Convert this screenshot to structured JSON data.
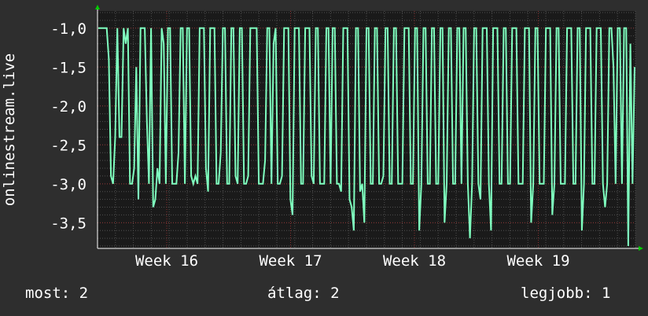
{
  "chart_data": {
    "type": "line",
    "ylabel": "onlinestream.live",
    "ylim": [
      -3.83,
      -0.78
    ],
    "y_ticks": [
      -1.0,
      -1.5,
      -2.0,
      -2.5,
      -3.0,
      -3.5
    ],
    "y_tick_labels": [
      "-1,0",
      "-1,5",
      "-2,0",
      "-2,5",
      "-3,0",
      "-3,5"
    ],
    "x_tick_labels": [
      "Week 16",
      "Week 17",
      "Week 18",
      "Week 19"
    ],
    "grid": true,
    "colors": {
      "background": "#2e2e2e",
      "plot_area": "#1a1a1a",
      "line": "#7fffbf",
      "grid_major": "#8a3030",
      "grid_minor": "#505050",
      "axis_arrow": "#00cc00"
    },
    "series": [
      {
        "values": [
          -1.0,
          -1.0,
          -1.0,
          -1.0,
          -1.0,
          -1.4,
          -2.9,
          -3.0,
          -2.4,
          -1.0,
          -2.4,
          -2.4,
          -1.0,
          -1.2,
          -1.0,
          -3.0,
          -3.0,
          -2.8,
          -1.5,
          -3.2,
          -1.0,
          -1.0,
          -1.0,
          -2.2,
          -3.0,
          -1.0,
          -3.3,
          -3.2,
          -2.8,
          -3.0,
          -1.0,
          -1.2,
          -3.0,
          -1.0,
          -1.0,
          -3.0,
          -3.0,
          -3.0,
          -2.6,
          -1.0,
          -1.0,
          -3.0,
          -1.0,
          -1.0,
          -2.9,
          -3.0,
          -2.9,
          -3.0,
          -1.0,
          -1.0,
          -1.0,
          -2.8,
          -3.1,
          -1.0,
          -1.0,
          -1.0,
          -3.0,
          -3.0,
          -2.6,
          -1.0,
          -1.0,
          -3.0,
          -3.0,
          -1.0,
          -1.0,
          -2.9,
          -3.0,
          -1.0,
          -1.0,
          -3.0,
          -3.0,
          -2.9,
          -1.0,
          -1.0,
          -1.0,
          -1.0,
          -3.0,
          -3.0,
          -3.0,
          -2.7,
          -1.0,
          -1.0,
          -3.0,
          -1.2,
          -1.0,
          -3.0,
          -3.0,
          -2.9,
          -1.0,
          -1.0,
          -1.0,
          -3.2,
          -3.4,
          -1.0,
          -1.0,
          -1.0,
          -3.0,
          -3.0,
          -1.0,
          -1.0,
          -1.0,
          -2.9,
          -3.0,
          -1.0,
          -1.0,
          -3.0,
          -3.0,
          -3.0,
          -1.0,
          -1.0,
          -3.0,
          -1.0,
          -1.0,
          -3.0,
          -3.0,
          -3.1,
          -1.0,
          -1.0,
          -1.0,
          -3.2,
          -3.3,
          -3.6,
          -1.0,
          -1.0,
          -3.1,
          -3.0,
          -3.5,
          -1.0,
          -1.0,
          -3.0,
          -3.0,
          -1.0,
          -1.0,
          -3.0,
          -3.0,
          -2.9,
          -1.0,
          -1.0,
          -3.0,
          -3.0,
          -1.0,
          -1.0,
          -3.0,
          -3.0,
          -3.0,
          -1.0,
          -1.0,
          -1.0,
          -3.0,
          -3.0,
          -1.0,
          -1.0,
          -3.6,
          -3.0,
          -1.0,
          -1.0,
          -3.0,
          -3.0,
          -1.0,
          -1.0,
          -3.0,
          -3.0,
          -1.0,
          -1.0,
          -3.5,
          -3.0,
          -1.0,
          -1.0,
          -3.0,
          -3.0,
          -1.0,
          -1.0,
          -3.0,
          -1.0,
          -1.0,
          -3.0,
          -3.7,
          -3.0,
          -1.0,
          -1.0,
          -3.0,
          -3.2,
          -1.0,
          -1.0,
          -1.0,
          -3.0,
          -3.6,
          -1.0,
          -1.0,
          -1.0,
          -3.0,
          -3.0,
          -1.0,
          -1.0,
          -3.0,
          -3.0,
          -1.0,
          -1.0,
          -1.0,
          -3.0,
          -3.0,
          -3.0,
          -1.0,
          -1.0,
          -1.0,
          -3.5,
          -3.0,
          -1.0,
          -1.0,
          -3.0,
          -3.0,
          -3.0,
          -1.0,
          -1.0,
          -1.0,
          -3.4,
          -3.0,
          -1.0,
          -1.0,
          -3.0,
          -3.0,
          -3.0,
          -1.0,
          -1.0,
          -1.0,
          -3.0,
          -3.0,
          -1.0,
          -1.0,
          -3.6,
          -3.0,
          -1.0,
          -1.0,
          -1.0,
          -3.0,
          -3.0,
          -1.0,
          -1.0,
          -1.0,
          -3.0,
          -3.3,
          -3.0,
          -1.0,
          -1.0,
          -1.5,
          -3.0,
          -1.0,
          -1.0,
          -3.0,
          -1.0,
          -1.0,
          -3.8,
          -1.2,
          -3.0,
          -1.5
        ]
      }
    ]
  },
  "footer": {
    "now": "most: 2",
    "average": "átlag: 2",
    "best": "legjobb: 1"
  }
}
